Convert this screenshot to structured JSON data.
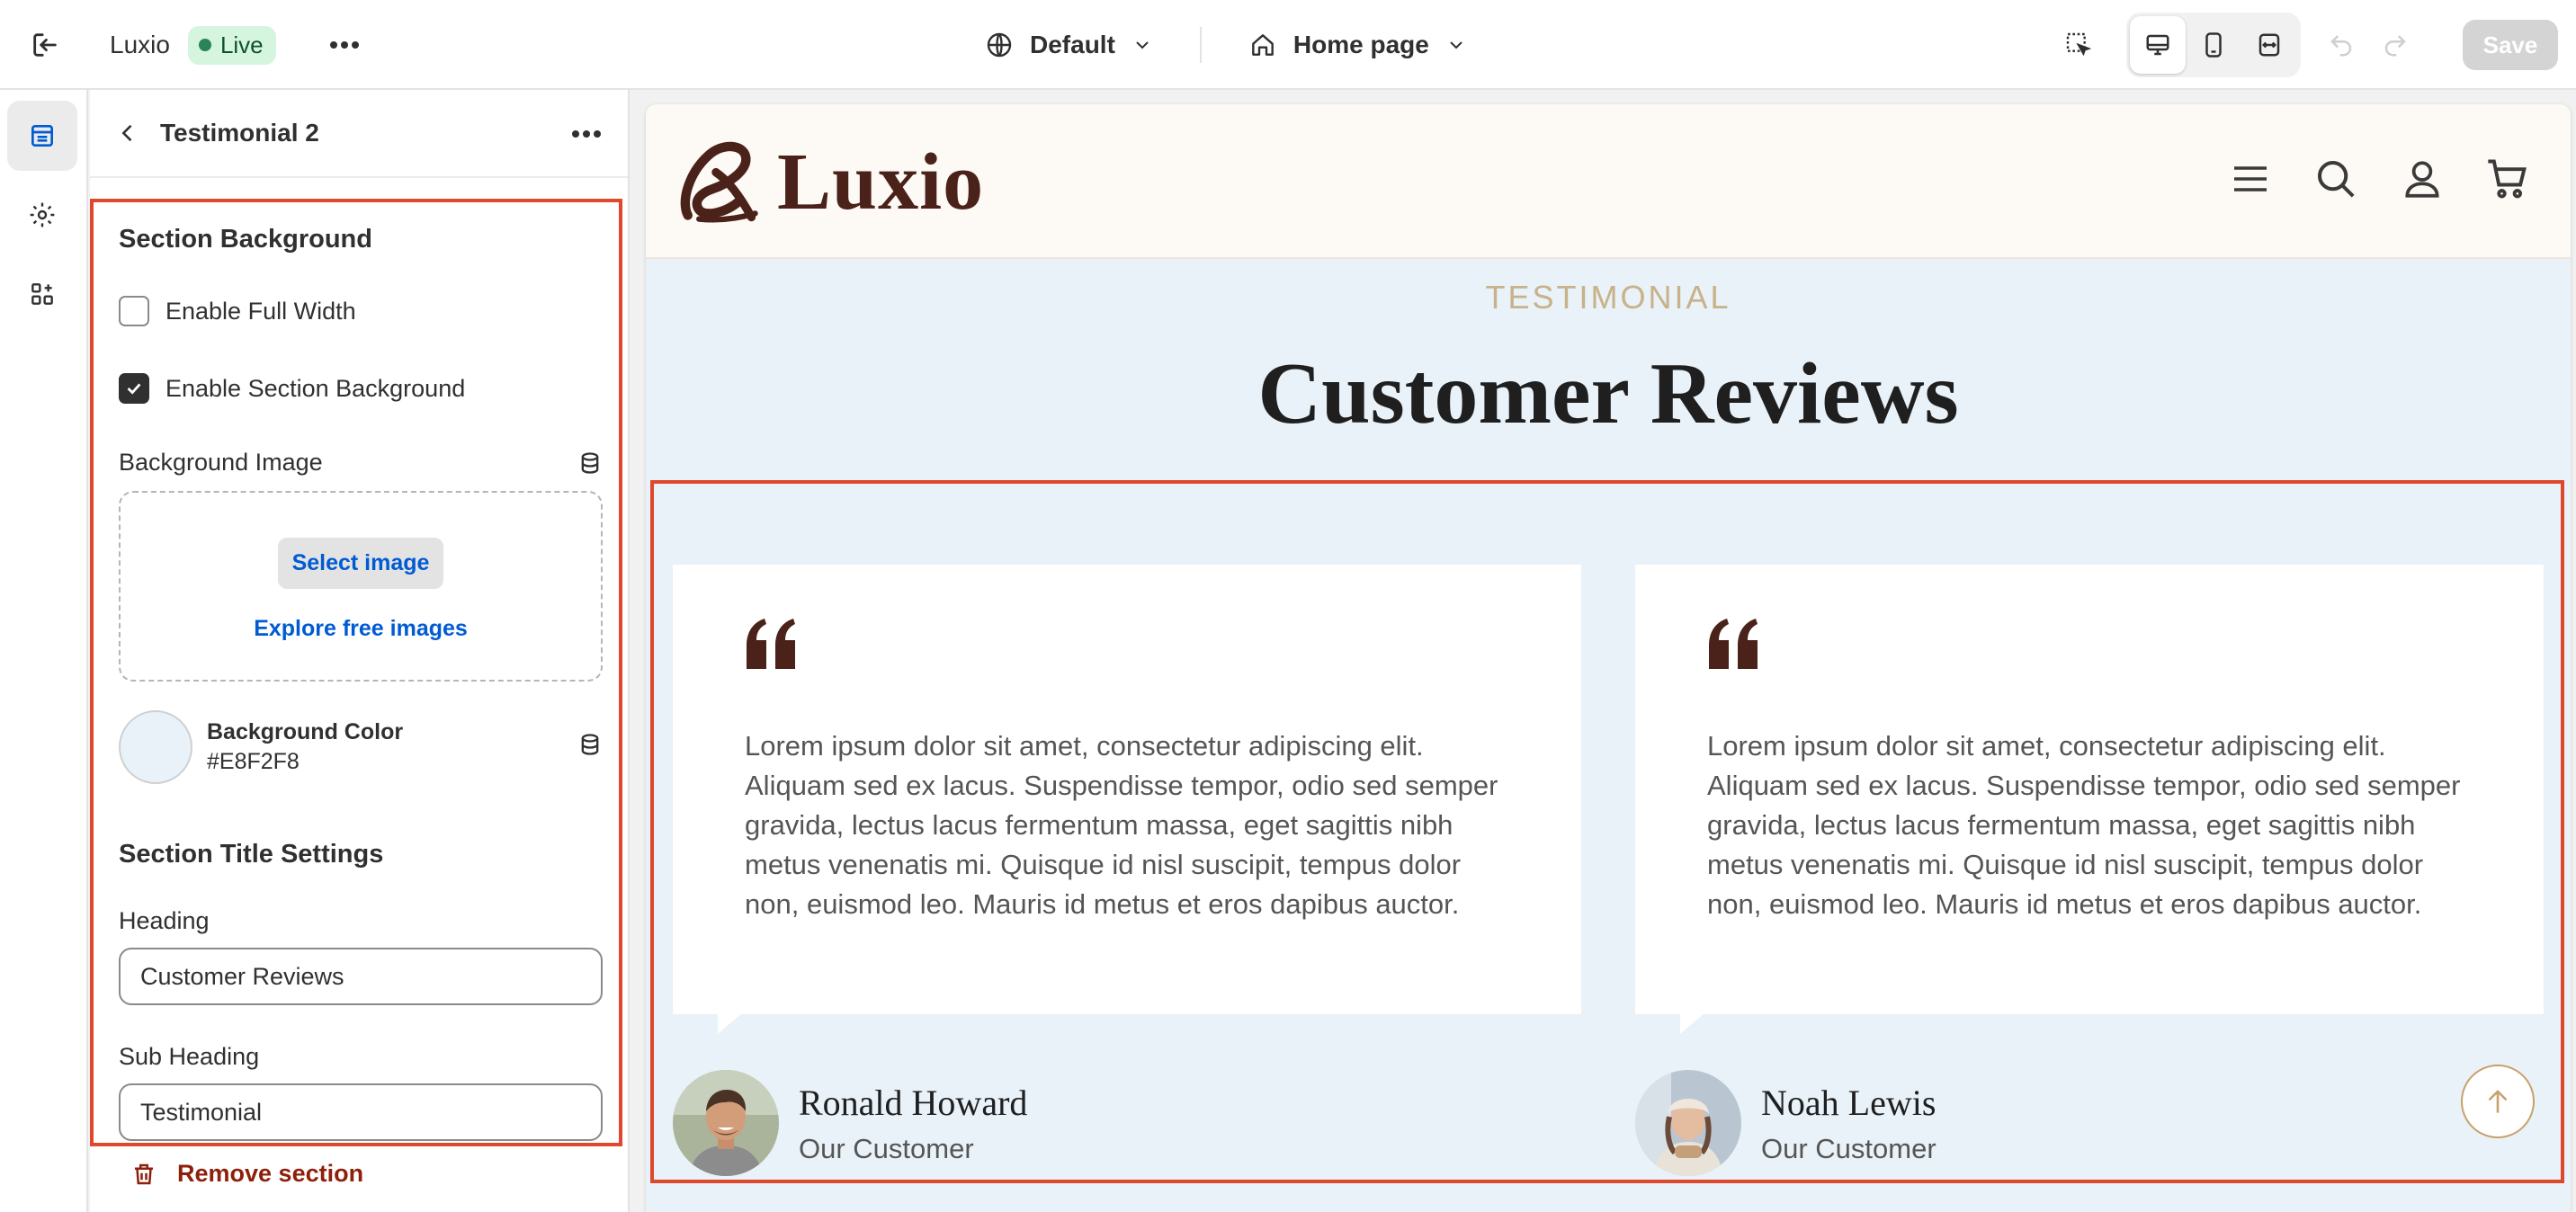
{
  "topbar": {
    "store_name": "Luxio",
    "status_badge": "Live",
    "theme_selector": "Default",
    "page_selector": "Home page",
    "save_label": "Save"
  },
  "panel": {
    "title": "Testimonial 2",
    "background_section_title": "Section Background",
    "enable_full_width": {
      "label": "Enable Full Width",
      "checked": false
    },
    "enable_section_background": {
      "label": "Enable Section Background",
      "checked": true
    },
    "background_image_label": "Background Image",
    "select_image_label": "Select image",
    "explore_images_label": "Explore free images",
    "background_color": {
      "label": "Background Color",
      "value": "#E8F2F8"
    },
    "title_settings_title": "Section Title Settings",
    "heading_label": "Heading",
    "heading_value": "Customer Reviews",
    "sub_heading_label": "Sub Heading",
    "sub_heading_value": "Testimonial",
    "remove_section_label": "Remove section"
  },
  "preview": {
    "logo_text": "Luxio",
    "subheading": "TESTIMONIAL",
    "heading": "Customer Reviews",
    "testimonials": [
      {
        "text": "Lorem ipsum dolor sit amet, consectetur adipiscing elit. Aliquam sed ex lacus. Suspendisse tempor, odio sed semper gravida, lectus lacus fermentum massa, eget sagittis nibh metus venenatis mi. Quisque id nisl suscipit, tempus dolor non, euismod leo. Mauris id metus et eros dapibus auctor.",
        "name": "Ronald Howard",
        "role": "Our Customer"
      },
      {
        "text": "Lorem ipsum dolor sit amet, consectetur adipiscing elit. Aliquam sed ex lacus. Suspendisse tempor, odio sed semper gravida, lectus lacus fermentum massa, eget sagittis nibh metus venenatis mi. Quisque id nisl suscipit, tempus dolor non, euismod leo. Mauris id metus et eros dapibus auctor.",
        "name": "Noah Lewis",
        "role": "Our Customer"
      }
    ]
  },
  "colors": {
    "accent_highlight": "#e0482d",
    "section_background": "#E8F2F8",
    "brand_brown": "#4a2219",
    "link_blue": "#005bd3",
    "subheading_gold": "#c9b189"
  }
}
